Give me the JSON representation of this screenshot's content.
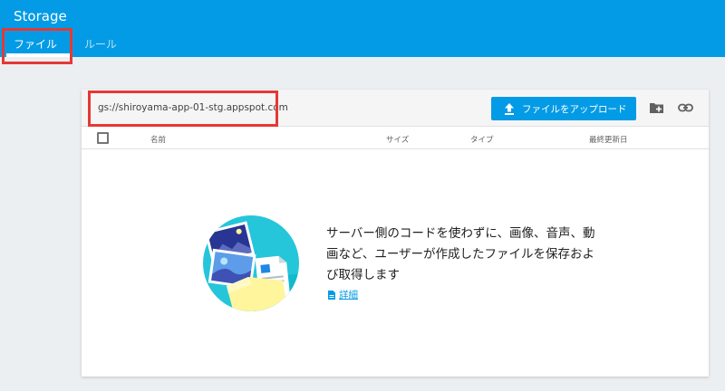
{
  "header": {
    "title": "Storage",
    "tabs": [
      {
        "label": "ファイル",
        "active": true
      },
      {
        "label": "ルール",
        "active": false
      }
    ],
    "background": "#039be5"
  },
  "toolbar": {
    "bucket_path": "gs://shiroyama-app-01-stg.appspot.com",
    "upload_label": "ファイルをアップロード",
    "upload_icon": "upload-icon",
    "folder_icon": "create-folder-icon",
    "link_icon": "link-icon"
  },
  "table": {
    "columns": [
      "名前",
      "サイズ",
      "タイプ",
      "最終更新日"
    ]
  },
  "empty_state": {
    "message": "サーバー側のコードを使わずに、画像、音声、動画など、ユーザーが作成したファイルを保存および取得します",
    "details_label": "詳細",
    "details_icon": "document-icon"
  },
  "colors": {
    "accent": "#039be5",
    "highlight": "#e53935"
  }
}
